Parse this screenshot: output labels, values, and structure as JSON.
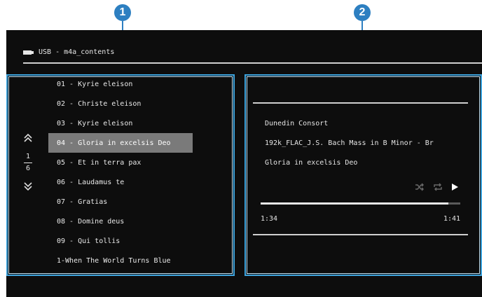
{
  "callouts": [
    "1",
    "2"
  ],
  "source": {
    "icon": "usb-icon",
    "label": "USB - m4a_contents"
  },
  "navigation": {
    "page_current": "1",
    "page_total": "6"
  },
  "tracks": [
    {
      "label": "01 - Kyrie eleison",
      "selected": false
    },
    {
      "label": "02 - Christe eleison",
      "selected": false
    },
    {
      "label": "03 - Kyrie eleison",
      "selected": false
    },
    {
      "label": "04 - Gloria in excelsis Deo",
      "selected": true
    },
    {
      "label": "05 - Et in terra pax",
      "selected": false
    },
    {
      "label": "06 - Laudamus te",
      "selected": false
    },
    {
      "label": "07 - Gratias",
      "selected": false
    },
    {
      "label": "08 - Domine deus",
      "selected": false
    },
    {
      "label": "09 - Qui tollis",
      "selected": false
    },
    {
      "label": "1-When The World Turns Blue",
      "selected": false
    }
  ],
  "now_playing": {
    "artist": "Dunedin Consort",
    "album": "192k_FLAC_J.S. Bach Mass in B Minor - Br",
    "title": "Gloria in excelsis Deo",
    "elapsed": "1:34",
    "total": "1:41",
    "progress_fraction": 0.94
  },
  "colors": {
    "callout": "#2d7fc1",
    "frame": "#3da3dd",
    "selected_bg": "#7a7a7a"
  }
}
